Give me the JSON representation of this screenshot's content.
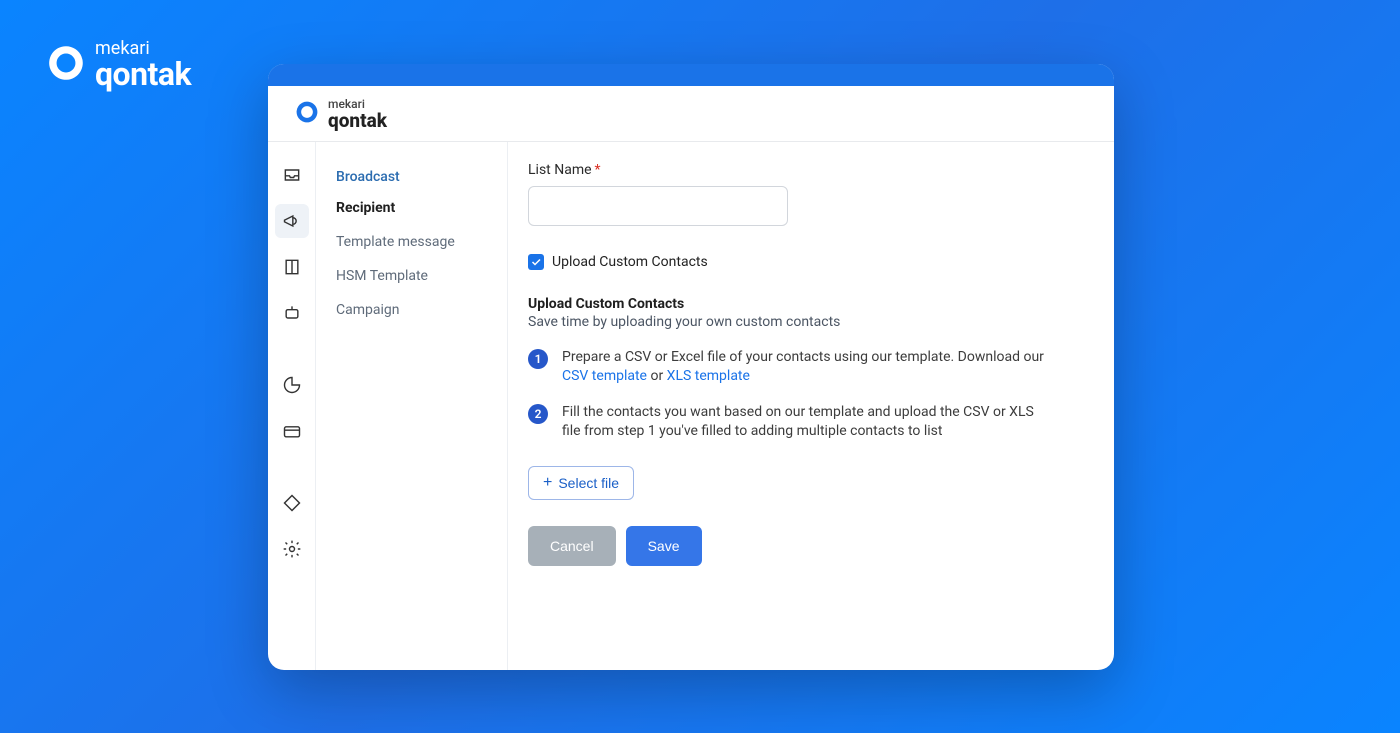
{
  "outer_brand": {
    "top": "mekari",
    "bottom": "qontak"
  },
  "app_brand": {
    "top": "mekari",
    "bottom": "qontak"
  },
  "rail": {
    "items": [
      {
        "name": "inbox-icon"
      },
      {
        "name": "megaphone-icon"
      },
      {
        "name": "book-icon"
      },
      {
        "name": "bot-icon"
      },
      {
        "name": "chart-pie-icon"
      },
      {
        "name": "card-icon"
      },
      {
        "name": "tag-icon"
      },
      {
        "name": "gear-icon"
      }
    ]
  },
  "subnav": {
    "header": "Broadcast",
    "items": [
      {
        "label": "Recipient",
        "active": true
      },
      {
        "label": "Template message",
        "active": false
      },
      {
        "label": "HSM Template",
        "active": false
      },
      {
        "label": "Campaign",
        "active": false
      }
    ]
  },
  "form": {
    "list_name_label": "List Name",
    "required_mark": "*",
    "list_name_value": "",
    "checkbox_label": "Upload Custom Contacts",
    "checkbox_checked": true,
    "section_title": "Upload Custom Contacts",
    "section_sub": "Save time by uploading your own custom contacts",
    "steps": [
      {
        "num": "1",
        "prefix": "Prepare a CSV or Excel file of your contacts using our template. Download our ",
        "link1": "CSV template",
        "mid": " or ",
        "link2": "XLS template"
      },
      {
        "num": "2",
        "text": "Fill the contacts you want based on our template and upload the CSV or XLS file from step 1 you've filled to adding multiple contacts to list"
      }
    ],
    "select_file_label": "Select file",
    "cancel_label": "Cancel",
    "save_label": "Save"
  }
}
